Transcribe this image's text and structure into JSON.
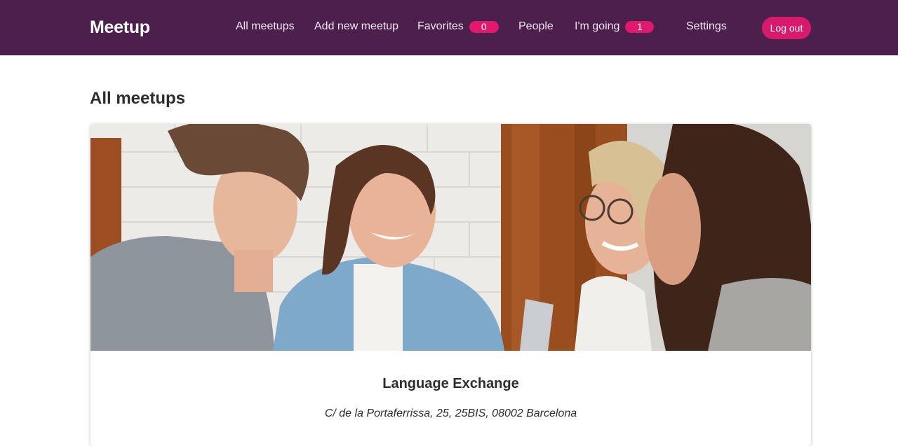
{
  "header": {
    "logo": "Meetup",
    "nav": {
      "all_meetups": "All meetups",
      "add_new_meetup": "Add new meetup",
      "favorites": "Favorites",
      "favorites_count": "0",
      "people": "People",
      "im_going": "I'm going",
      "im_going_count": "1",
      "settings": "Settings"
    },
    "logout_label": "Log out"
  },
  "main": {
    "title": "All meetups",
    "meetups": [
      {
        "title": "Language Exchange",
        "address": "C/ de la Portaferrissa, 25, 25BIS, 08002 Barcelona",
        "image": "photo-four-people-smiling"
      }
    ]
  },
  "colors": {
    "header_bg": "#4d1f4c",
    "accent": "#e0196e",
    "nav_text": "#f1e4f0"
  }
}
